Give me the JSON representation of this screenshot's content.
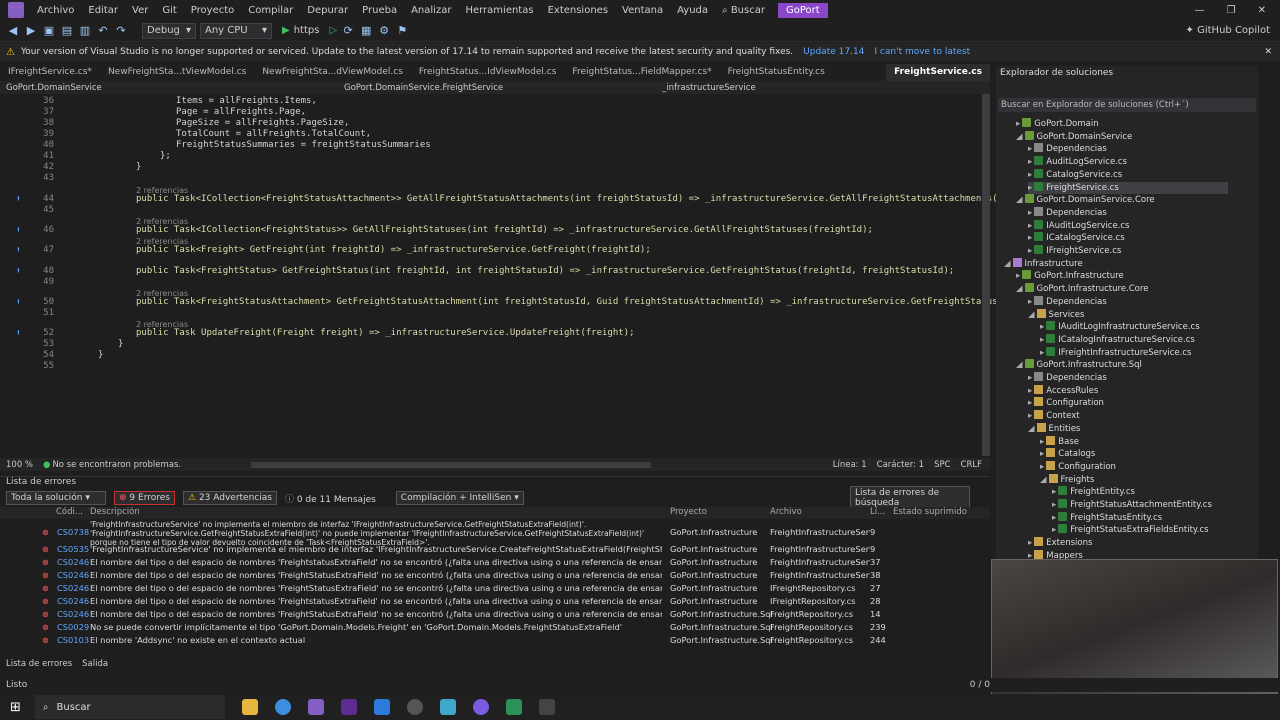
{
  "menu": {
    "items": [
      "Archivo",
      "Editar",
      "Ver",
      "Git",
      "Proyecto",
      "Compilar",
      "Depurar",
      "Prueba",
      "Analizar",
      "Herramientas",
      "Extensiones",
      "Ventana",
      "Ayuda"
    ],
    "search": "Buscar",
    "solution_badge": "GoPort"
  },
  "toolbar": {
    "config": "Debug",
    "platform": "Any CPU",
    "run": "https",
    "copilot": "GitHub Copilot"
  },
  "notice": {
    "text": "Your version of Visual Studio is no longer supported or serviced. Update to the latest version of 17.14 to remain supported and receive the latest security and quality fixes.",
    "update": "Update 17.14",
    "skip": "I can't move to latest"
  },
  "tabs": [
    "IFreightService.cs*",
    "NewFreightSta...tViewModel.cs",
    "NewFreightSta...dViewModel.cs",
    "FreightStatus...IdViewModel.cs",
    "FreightStatus...FieldMapper.cs*",
    "FreightStatusEntity.cs",
    "FreightService.cs"
  ],
  "nav": {
    "project": "GoPort.DomainService",
    "class": "GoPort.DomainService.FreightService",
    "member": "_infrastructureService"
  },
  "code": {
    "refs": "2 referencias",
    "lines": [
      {
        "n": "36",
        "t": "Items = allFreights.Items,"
      },
      {
        "n": "37",
        "t": "Page = allFreights.Page,"
      },
      {
        "n": "38",
        "t": "PageSize = allFreights.PageSize,"
      },
      {
        "n": "39",
        "t": "TotalCount = allFreights.TotalCount,"
      },
      {
        "n": "40",
        "t": "FreightStatusSummaries = freightStatusSummaries"
      },
      {
        "n": "41",
        "t": "};"
      },
      {
        "n": "42",
        "t": "}"
      },
      {
        "n": "43",
        "t": ""
      },
      {
        "n": "44",
        "t": "public Task<ICollection<FreightStatusAttachment>> GetAllFreightStatusAttachments(int freightStatusId) => _infrastructureService.GetAllFreightStatusAttachments(freight"
      },
      {
        "n": "45",
        "t": ""
      },
      {
        "n": "46",
        "t": "public Task<ICollection<FreightStatus>> GetAllFreightStatuses(int freightId) => _infrastructureService.GetAllFreightStatuses(freightId);"
      },
      {
        "n": "47",
        "t": "public Task<Freight> GetFreight(int freightId) => _infrastructureService.GetFreight(freightId);"
      },
      {
        "n": "48",
        "t": "public Task<FreightStatus> GetFreightStatus(int freightId, int freightStatusId) => _infrastructureService.GetFreightStatus(freightId, freightStatusId);"
      },
      {
        "n": "49",
        "t": ""
      },
      {
        "n": "50",
        "t": "public Task<FreightStatusAttachment> GetFreightStatusAttachment(int freightStatusId, Guid freightStatusAttachmentId) => _infrastructureService.GetFreightStatusAttachm"
      },
      {
        "n": "51",
        "t": ""
      },
      {
        "n": "52",
        "t": "public Task UpdateFreight(Freight freight) => _infrastructureService.UpdateFreight(freight);"
      },
      {
        "n": "53",
        "t": "}"
      },
      {
        "n": "54",
        "t": "}"
      },
      {
        "n": "55",
        "t": ""
      }
    ]
  },
  "editor_status": {
    "zoom": "100 %",
    "problems": "No se encontraron problemas.",
    "line": "Línea: 1",
    "char": "Carácter: 1",
    "enc": "SPC",
    "eol": "CRLF"
  },
  "errors": {
    "title": "Lista de errores",
    "scope": "Toda la solución",
    "err_count": "9 Errores",
    "warn_count": "23 Advertencias",
    "msg_count": "0 de 11 Mensajes",
    "build": "Compilación + IntelliSen",
    "search": "Lista de errores de búsqueda",
    "columns": [
      "Códi...",
      "Descripción",
      "Proyecto",
      "Archivo",
      "Lí...",
      "Estado suprimido"
    ],
    "rows": [
      {
        "code": "CS0738",
        "desc": "'FreightInfrastructureService' no implementa el miembro de interfaz 'IFreightInfrastructureService.GetFreightStatusExtraField(int)'. 'FreightInfrastructureService.GetFreightStatusExtraField(int)' no puede implementar 'IFreightInfrastructureService.GetFreightStatusExtraField(int)' porque no tiene el tipo de valor devuelto coincidente de 'Task<FreightStatusExtraField>'.",
        "proj": "GoPort.Infrastructure",
        "file": "FreightInfrastructureServic...",
        "line": "9"
      },
      {
        "code": "CS0535",
        "desc": "'FreightInfrastructureService' no implementa el miembro de interfaz 'IFreightInfrastructureService.CreateFreightStatusExtraField(FreightStatusExtraField)'",
        "proj": "GoPort.Infrastructure",
        "file": "FreightInfrastructureServic...",
        "line": "9"
      },
      {
        "code": "CS0246",
        "desc": "El nombre del tipo o del espacio de nombres 'FreightstatusExtraField' no se encontró (¿falta una directiva using o una referencia de ensamblado?)",
        "proj": "GoPort.Infrastructure",
        "file": "FreightInfrastructureServic...",
        "line": "37"
      },
      {
        "code": "CS0246",
        "desc": "El nombre del tipo o del espacio de nombres 'FreightStatusExtraField' no se encontró (¿falta una directiva using o una referencia de ensamblado?)",
        "proj": "GoPort.Infrastructure",
        "file": "FreightInfrastructureServic...",
        "line": "38"
      },
      {
        "code": "CS0246",
        "desc": "El nombre del tipo o del espacio de nombres 'FreightStatusExtraField' no se encontró (¿falta una directiva using o una referencia de ensamblado?)",
        "proj": "GoPort.Infrastructure",
        "file": "IFreightRepository.cs",
        "line": "27"
      },
      {
        "code": "CS0246",
        "desc": "El nombre del tipo o del espacio de nombres 'FreightstatusExtraField' no se encontró (¿falta una directiva using o una referencia de ensamblado?)",
        "proj": "GoPort.Infrastructure",
        "file": "IFreightRepository.cs",
        "line": "28"
      },
      {
        "code": "CS0246",
        "desc": "El nombre del tipo o del espacio de nombres 'FreightStatusExtraField' no se encontró (¿falta una directiva using o una referencia de ensamblado?)",
        "proj": "GoPort.Infrastructure.Sql",
        "file": "FreightRepository.cs",
        "line": "14"
      },
      {
        "code": "CS0029",
        "desc": "No se puede convertir implícitamente el tipo 'GoPort.Domain.Models.Freight' en 'GoPort.Domain.Models.FreightStatusExtraField'",
        "proj": "GoPort.Infrastructure.Sql",
        "file": "FreightRepository.cs",
        "line": "239"
      },
      {
        "code": "CS0103",
        "desc": "El nombre 'Addsync' no existe en el contexto actual",
        "proj": "GoPort.Infrastructure.Sql",
        "file": "FreightRepository.cs",
        "line": "244"
      }
    ],
    "tabs": [
      "Lista de errores",
      "Salida"
    ]
  },
  "solution": {
    "title": "Explorador de soluciones",
    "search": "Buscar en Explorador de soluciones (Ctrl+´)",
    "nodes": [
      {
        "l": "GoPort.Domain",
        "d": 2,
        "i": "proj",
        "a": "▸"
      },
      {
        "l": "GoPort.DomainService",
        "d": 2,
        "i": "proj",
        "a": "◢"
      },
      {
        "l": "Dependencias",
        "d": 3,
        "i": "dep",
        "a": "▸"
      },
      {
        "l": "AuditLogService.cs",
        "d": 3,
        "i": "cs",
        "a": "▸"
      },
      {
        "l": "CatalogService.cs",
        "d": 3,
        "i": "cs",
        "a": "▸"
      },
      {
        "l": "FreightService.cs",
        "d": 3,
        "i": "cs",
        "a": "▸",
        "sel": true
      },
      {
        "l": "GoPort.DomainService.Core",
        "d": 2,
        "i": "proj",
        "a": "◢"
      },
      {
        "l": "Dependencias",
        "d": 3,
        "i": "dep",
        "a": "▸"
      },
      {
        "l": "IAuditLogService.cs",
        "d": 3,
        "i": "cs",
        "a": "▸"
      },
      {
        "l": "ICatalogService.cs",
        "d": 3,
        "i": "cs",
        "a": "▸"
      },
      {
        "l": "IFreightService.cs",
        "d": 3,
        "i": "cs",
        "a": "▸"
      },
      {
        "l": "Infrastructure",
        "d": 1,
        "i": "sol",
        "a": "◢"
      },
      {
        "l": "GoPort.Infrastructure",
        "d": 2,
        "i": "proj",
        "a": "▸"
      },
      {
        "l": "GoPort.Infrastructure.Core",
        "d": 2,
        "i": "proj",
        "a": "◢"
      },
      {
        "l": "Dependencias",
        "d": 3,
        "i": "dep",
        "a": "▸"
      },
      {
        "l": "Services",
        "d": 3,
        "i": "fold",
        "a": "◢"
      },
      {
        "l": "IAuditLogInfrastructureService.cs",
        "d": 4,
        "i": "cs",
        "a": "▸"
      },
      {
        "l": "ICatalogInfrastructureService.cs",
        "d": 4,
        "i": "cs",
        "a": "▸"
      },
      {
        "l": "IFreightInfrastructureService.cs",
        "d": 4,
        "i": "cs",
        "a": "▸"
      },
      {
        "l": "GoPort.Infrastructure.Sql",
        "d": 2,
        "i": "proj",
        "a": "◢"
      },
      {
        "l": "Dependencias",
        "d": 3,
        "i": "dep",
        "a": "▸"
      },
      {
        "l": "AccessRules",
        "d": 3,
        "i": "fold",
        "a": "▸"
      },
      {
        "l": "Configuration",
        "d": 3,
        "i": "fold",
        "a": "▸"
      },
      {
        "l": "Context",
        "d": 3,
        "i": "fold",
        "a": "▸"
      },
      {
        "l": "Entities",
        "d": 3,
        "i": "fold",
        "a": "◢"
      },
      {
        "l": "Base",
        "d": 4,
        "i": "fold",
        "a": "▸"
      },
      {
        "l": "Catalogs",
        "d": 4,
        "i": "fold",
        "a": "▸"
      },
      {
        "l": "Configuration",
        "d": 4,
        "i": "fold",
        "a": "▸"
      },
      {
        "l": "Freights",
        "d": 4,
        "i": "fold",
        "a": "◢"
      },
      {
        "l": "FreightEntity.cs",
        "d": 5,
        "i": "cs",
        "a": "▸"
      },
      {
        "l": "FreightStatusAttachmentEntity.cs",
        "d": 5,
        "i": "cs",
        "a": "▸"
      },
      {
        "l": "FreightStatusEntity.cs",
        "d": 5,
        "i": "cs",
        "a": "▸"
      },
      {
        "l": "FreightStatusExtraFieldsEntity.cs",
        "d": 5,
        "i": "cs",
        "a": "▸"
      },
      {
        "l": "Extensions",
        "d": 3,
        "i": "fold",
        "a": "▸"
      },
      {
        "l": "Mappers",
        "d": 3,
        "i": "fold",
        "a": "▸"
      }
    ]
  },
  "status": {
    "text": "Listo",
    "pos": "0 / 0"
  },
  "taskbar": {
    "search": "Buscar"
  }
}
